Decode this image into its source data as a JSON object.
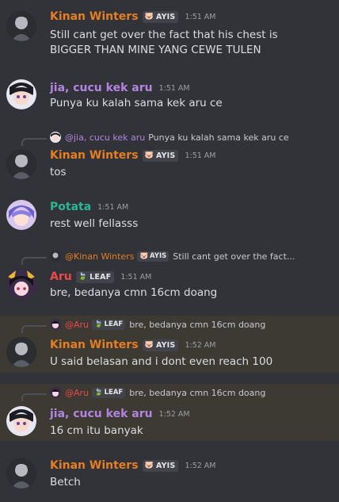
{
  "colors": {
    "kinan": "#e67e22",
    "jia": "#b384e0",
    "potata": "#2bb594",
    "aru": "#f04747",
    "background": "#313338",
    "highlight": "#3c3a33"
  },
  "messages": [
    {
      "author": "Kinan Winters",
      "tag": "AYIS",
      "tag_icon": "pig-icon",
      "time": "1:51 AM",
      "lines": [
        "Still cant get over the fact that his chest is",
        "BIGGER THAN MINE YANG CEWE TULEN"
      ]
    },
    {
      "author": "jia, cucu kek aru",
      "time": "1:51 AM",
      "lines": [
        "Punya ku kalah sama kek aru ce"
      ]
    },
    {
      "reply": {
        "author": "@jia, cucu kek aru",
        "text": "Punya ku kalah sama kek aru ce"
      },
      "author": "Kinan Winters",
      "tag": "AYIS",
      "tag_icon": "pig-icon",
      "time": "1:51 AM",
      "lines": [
        "tos"
      ]
    },
    {
      "author": "Potata",
      "time": "1:51 AM",
      "lines": [
        "rest well fellasss"
      ]
    },
    {
      "reply": {
        "author": "@Kinan Winters",
        "tag": "AYIS",
        "text": "Still cant get over the fact..."
      },
      "author": "Aru",
      "tag": "LEAF",
      "tag_icon": "leaf-icon",
      "time": "1:51 AM",
      "lines": [
        "bre, bedanya cmn 16cm doang"
      ]
    },
    {
      "reply": {
        "author": "@Aru",
        "tag": "LEAF",
        "text": "bre, bedanya cmn 16cm doang"
      },
      "author": "Kinan Winters",
      "tag": "AYIS",
      "tag_icon": "pig-icon",
      "time": "1:52 AM",
      "lines": [
        "U said belasan and i dont even reach 100"
      ]
    },
    {
      "reply": {
        "author": "@Aru",
        "tag": "LEAF",
        "text": "bre, bedanya cmn 16cm doang"
      },
      "author": "jia, cucu kek aru",
      "time": "1:52 AM",
      "lines": [
        "16 cm itu banyak"
      ]
    },
    {
      "author": "Kinan Winters",
      "tag": "AYIS",
      "tag_icon": "pig-icon",
      "time": "1:52 AM",
      "lines": [
        "Betch"
      ]
    }
  ]
}
